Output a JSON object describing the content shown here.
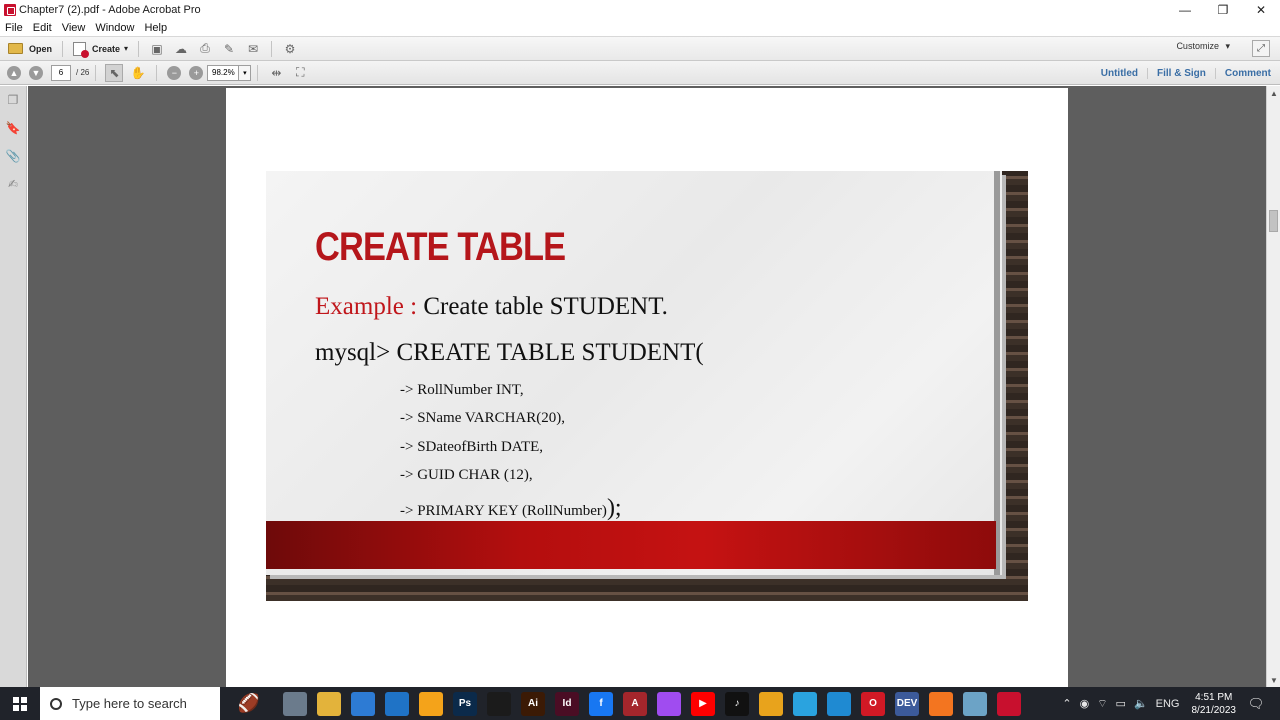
{
  "window": {
    "title": "Chapter7 (2).pdf - Adobe Acrobat Pro",
    "controls": {
      "minimize": "—",
      "restore": "❐",
      "close": "✕"
    }
  },
  "menu": [
    "File",
    "Edit",
    "View",
    "Window",
    "Help"
  ],
  "toolbar1": {
    "open_label": "Open",
    "create_label": "Create",
    "create_dropdown": "▾",
    "customize_label": "Customize",
    "customize_dropdown": "▾"
  },
  "toolbar2": {
    "current_page": "6",
    "total_pages": "/ 26",
    "zoom": "98.2%",
    "zoom_dropdown": "▾",
    "links": [
      "Untitled",
      "Fill & Sign",
      "Comment"
    ]
  },
  "slide": {
    "title": "CREATE TABLE",
    "example_label": "Example :",
    "example_text": " Create table STUDENT.",
    "mysql_line": "mysql> CREATE TABLE STUDENT(",
    "fields": [
      "-> RollNumber INT,",
      "-> SName VARCHAR(20),",
      "-> SDateofBirth DATE,",
      "-> GUID CHAR (12),",
      "-> PRIMARY KEY (RollNumber)"
    ],
    "closing": ");"
  },
  "taskbar": {
    "search_placeholder": "Type here to search",
    "apps": [
      {
        "name": "camera-icon",
        "label": "",
        "color": "#6b7b8c"
      },
      {
        "name": "file-explorer-icon",
        "label": "",
        "color": "#e3b33b"
      },
      {
        "name": "store-icon",
        "label": "",
        "color": "#2d7bd4"
      },
      {
        "name": "mail-icon",
        "label": "",
        "color": "#1f73c6"
      },
      {
        "name": "frame-icon",
        "label": "",
        "color": "#f4a31a"
      },
      {
        "name": "photoshop-icon",
        "label": "Ps",
        "color": "#0b2a4a"
      },
      {
        "name": "capcut-icon",
        "label": "",
        "color": "#1b1b1b"
      },
      {
        "name": "illustrator-icon",
        "label": "Ai",
        "color": "#3b1a05"
      },
      {
        "name": "indesign-icon",
        "label": "Id",
        "color": "#4a0d24"
      },
      {
        "name": "facebook-icon",
        "label": "f",
        "color": "#1877f2"
      },
      {
        "name": "access-icon",
        "label": "A",
        "color": "#a4262c"
      },
      {
        "name": "messenger-icon",
        "label": "",
        "color": "#a04cf0"
      },
      {
        "name": "youtube-icon",
        "label": "▶",
        "color": "#ff0000"
      },
      {
        "name": "tiktok-icon",
        "label": "♪",
        "color": "#111111"
      },
      {
        "name": "chrome-icon",
        "label": "",
        "color": "#e8a31c"
      },
      {
        "name": "telegram-icon",
        "label": "",
        "color": "#2aa3df"
      },
      {
        "name": "vscode-icon",
        "label": "",
        "color": "#1f8ad2"
      },
      {
        "name": "opera-icon",
        "label": "O",
        "color": "#d11925"
      },
      {
        "name": "dev-icon",
        "label": "DEV",
        "color": "#3c5a9a"
      },
      {
        "name": "xampp-icon",
        "label": "",
        "color": "#f37520"
      },
      {
        "name": "notes-icon",
        "label": "",
        "color": "#6ca3c6"
      },
      {
        "name": "acrobat-icon",
        "label": "",
        "color": "#c8102e"
      }
    ],
    "clock_time": "4:51 PM",
    "clock_date": "8/21/2023"
  },
  "colors": {
    "title_red": "#b5161b",
    "link_blue": "#3a6ea5",
    "taskbar_bg": "#20232a"
  }
}
